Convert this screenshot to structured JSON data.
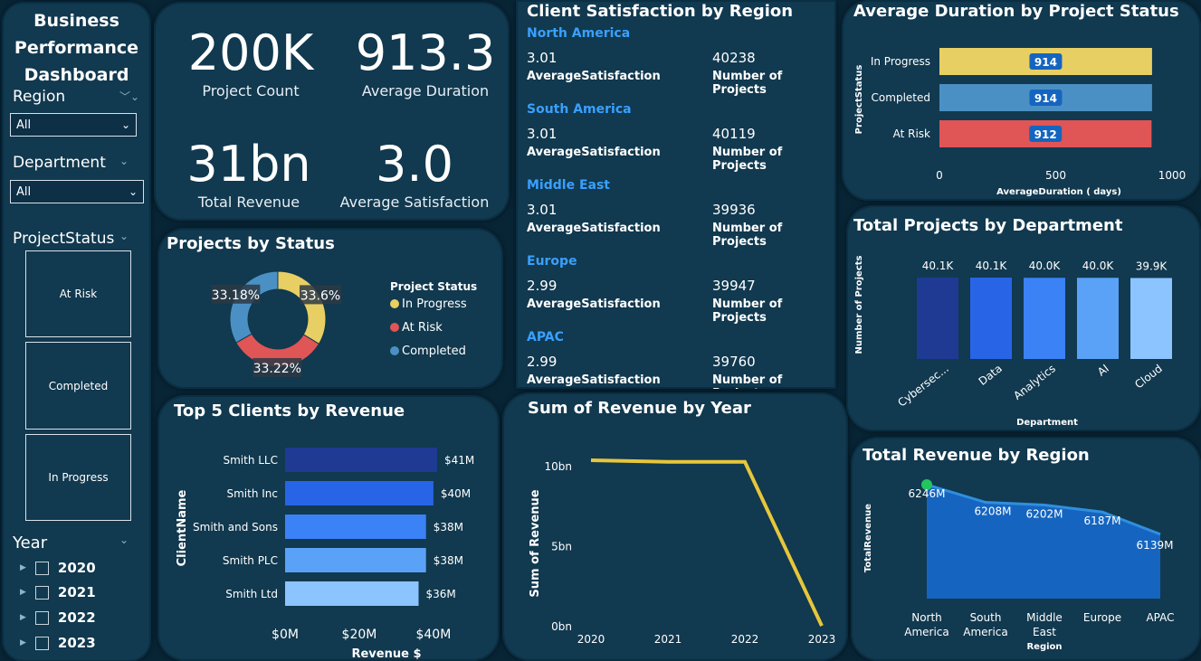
{
  "sidebar": {
    "title_line1": "Business",
    "title_line2": "Performance",
    "title_line3": "Dashboard",
    "region_label": "Region",
    "region_value": "All",
    "department_label": "Department",
    "department_value": "All",
    "status_label": "ProjectStatus",
    "status_tiles": [
      "At Risk",
      "Completed",
      "In Progress"
    ],
    "year_label": "Year",
    "years": [
      "2020",
      "2021",
      "2022",
      "2023"
    ]
  },
  "kpis": {
    "project_count": {
      "value": "200K",
      "label": "Project Count"
    },
    "avg_duration": {
      "value": "913.3",
      "label": "Average Duration"
    },
    "total_revenue": {
      "value": "31bn",
      "label": "Total Revenue"
    },
    "avg_satisfaction": {
      "value": "3.0",
      "label": "Average Satisfaction"
    }
  },
  "satisfaction": {
    "title": "Client Satisfaction by Region",
    "sat_label": "AverageSatisfaction",
    "proj_label": "Number of Projects",
    "regions": [
      {
        "name": "North America",
        "sat": "3.01",
        "projects": "40238"
      },
      {
        "name": "South America",
        "sat": "3.01",
        "projects": "40119"
      },
      {
        "name": "Middle East",
        "sat": "3.01",
        "projects": "39936"
      },
      {
        "name": "Europe",
        "sat": "2.99",
        "projects": "39947"
      },
      {
        "name": "APAC",
        "sat": "2.99",
        "projects": "39760"
      }
    ]
  },
  "colors": {
    "in_progress": "#e8cf63",
    "at_risk": "#e05555",
    "completed": "#4a90c4",
    "accent_blue": "#3aa0ff",
    "panel": "#11394f",
    "line_yellow": "#e7c63a"
  },
  "charts": [
    {
      "id": "duration",
      "title": "Average Duration by Project Status",
      "type": "bar",
      "orientation": "horizontal",
      "categories": [
        "In Progress",
        "Completed",
        "At Risk"
      ],
      "values": [
        914,
        914,
        912
      ],
      "data_labels": [
        "914",
        "914",
        "912"
      ],
      "bar_colors": [
        "#e8cf63",
        "#4a90c4",
        "#e05555"
      ],
      "xlim": [
        0,
        1000
      ],
      "xticks": [
        "0",
        "500",
        "1000"
      ],
      "xlabel": "AverageDuration ( days)",
      "ylabel": "ProjectStatus"
    },
    {
      "id": "status",
      "title": "Projects by Status",
      "type": "pie",
      "legend_title": "Project Status",
      "slices": [
        {
          "label": "In Progress",
          "value": 33.6,
          "text": "33.6%",
          "color": "#e8cf63"
        },
        {
          "label": "At Risk",
          "value": 33.22,
          "text": "33.22%",
          "color": "#e05555"
        },
        {
          "label": "Completed",
          "value": 33.18,
          "text": "33.18%",
          "color": "#4a90c4"
        }
      ]
    },
    {
      "id": "department",
      "title": "Total Projects by Department",
      "type": "bar",
      "categories": [
        "Cybersec...",
        "Data",
        "Analytics",
        "AI",
        "Cloud"
      ],
      "values": [
        40.1,
        40.1,
        40.0,
        40.0,
        39.9
      ],
      "data_labels": [
        "40.1K",
        "40.1K",
        "40.0K",
        "40.0K",
        "39.9K"
      ],
      "bar_colors": [
        "#1f3a93",
        "#2864e6",
        "#3b82f6",
        "#5aa2f7",
        "#8cc4ff"
      ],
      "xlabel": "Department",
      "ylabel": "Number of Projects"
    },
    {
      "id": "clients",
      "title": "Top 5 Clients by Revenue",
      "type": "bar",
      "orientation": "horizontal",
      "categories": [
        "Smith LLC",
        "Smith Inc",
        "Smith and Sons",
        "Smith PLC",
        "Smith Ltd"
      ],
      "values": [
        41,
        40,
        38,
        38,
        36
      ],
      "data_labels": [
        "$41M",
        "$40M",
        "$38M",
        "$38M",
        "$36M"
      ],
      "bar_colors": [
        "#1f3a93",
        "#2864e6",
        "#3b82f6",
        "#5aa2f7",
        "#8cc4ff"
      ],
      "xlim": [
        0,
        41
      ],
      "xticks": [
        "$0M",
        "$20M",
        "$40M"
      ],
      "xlabel": "Revenue $",
      "ylabel": "ClientName"
    },
    {
      "id": "year",
      "title": "Sum of Revenue by Year",
      "type": "line",
      "x": [
        "2020",
        "2021",
        "2022",
        "2023"
      ],
      "values": [
        10.4,
        10.3,
        10.3,
        0.05
      ],
      "ylim": [
        0,
        10.4
      ],
      "yticks": [
        "0bn",
        "5bn",
        "10bn"
      ],
      "ylabel": "Sum of Revenue"
    },
    {
      "id": "region",
      "title": "Total Revenue by Region",
      "type": "area",
      "categories": [
        "North America",
        "South America",
        "Middle East",
        "Europe",
        "APAC"
      ],
      "category_lines": [
        [
          "North",
          "America"
        ],
        [
          "South",
          "America"
        ],
        [
          "Middle",
          "East"
        ],
        [
          "Europe"
        ],
        [
          "APAC"
        ]
      ],
      "values": [
        6246,
        6208,
        6202,
        6187,
        6139
      ],
      "data_labels": [
        "6246M",
        "6208M",
        "6202M",
        "6187M",
        "6139M"
      ],
      "xlabel": "Region",
      "ylabel": "TotalRevenue"
    }
  ]
}
